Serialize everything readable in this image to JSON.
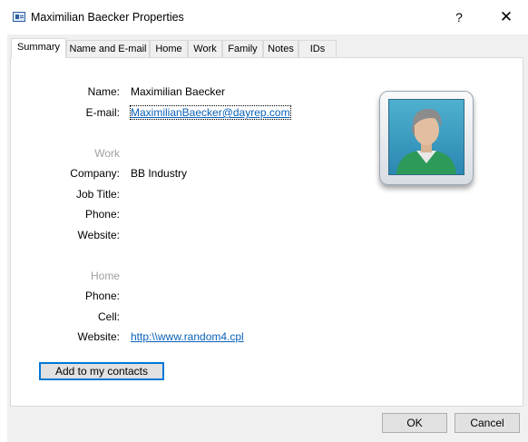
{
  "window": {
    "title": "Maximilian Baecker Properties",
    "help_label": "?",
    "close_label": "✕"
  },
  "tabs": [
    {
      "label": "Summary",
      "active": true
    },
    {
      "label": "Name and E-mail"
    },
    {
      "label": "Home"
    },
    {
      "label": "Work"
    },
    {
      "label": "Family"
    },
    {
      "label": "Notes"
    },
    {
      "label": "IDs"
    }
  ],
  "summary": {
    "name_label": "Name:",
    "name_value": "Maximilian Baecker",
    "email_label": "E-mail:",
    "email_value": "MaximilianBaecker@dayrep.com",
    "work_section": "Work",
    "company_label": "Company:",
    "company_value": "BB Industry",
    "job_title_label": "Job Title:",
    "work_phone_label": "Phone:",
    "work_website_label": "Website:",
    "home_section": "Home",
    "home_phone_label": "Phone:",
    "cell_label": "Cell:",
    "home_website_label": "Website:",
    "home_website_value": "http:\\\\www.random4.cpl",
    "add_contact_label": "Add to my contacts"
  },
  "footer": {
    "ok_label": "OK",
    "cancel_label": "Cancel"
  },
  "icons": {
    "title": "contact-card-icon",
    "photo": "contact-photo"
  },
  "colors": {
    "accent": "#0078d7",
    "link": "#0a61b8",
    "section_label": "#a0a0a0",
    "photo_background": "#3a9cc4",
    "shirt": "#2e9a5a"
  }
}
